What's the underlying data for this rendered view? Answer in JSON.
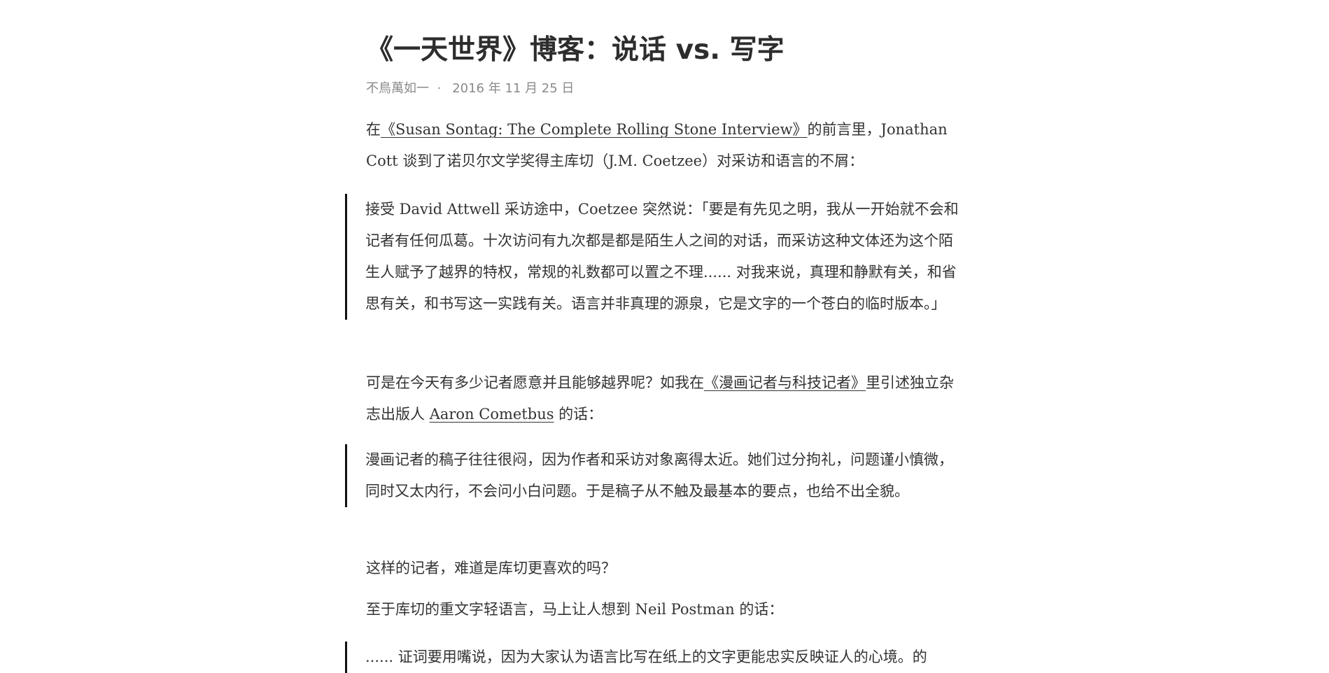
{
  "post": {
    "title": "《一天世界》博客：说话 vs. 写字",
    "author": "不鳥萬如一",
    "separator": "·",
    "date": "2016 年 11 月 25 日"
  },
  "paragraphs": {
    "p1_before": "在",
    "p1_link": "《Susan Sontag: The Complete Rolling Stone Interview》",
    "p1_after": "的前言里，Jonathan Cott 谈到了诺贝尔文学奖得主库切（J.M. Coetzee）对采访和语言的不屑：",
    "q1": "接受 David Attwell 采访途中，Coetzee 突然说：「要是有先见之明，我从一开始就不会和记者有任何瓜葛。十次访问有九次都是都是陌生人之间的对话，而采访这种文体还为这个陌生人赋予了越界的特权，常规的礼数都可以置之不理...... 对我来说，真理和静默有关，和省思有关，和书写这一实践有关。语言并非真理的源泉，它是文字的一个苍白的临时版本。」",
    "p2_before": "可是在今天有多少记者愿意并且能够越界呢？如我在",
    "p2_link1": "《漫画记者与科技记者》",
    "p2_middle": "里引述独立杂志出版人 ",
    "p2_link2": "Aaron Cometbus",
    "p2_after": " 的话：",
    "q2": "漫画记者的稿子往往很闷，因为作者和采访对象离得太近。她们过分拘礼，问题谨小慎微，同时又太内行，不会问小白问题。于是稿子从不触及最基本的要点，也给不出全貌。",
    "p3": "这样的记者，难道是库切更喜欢的吗？",
    "p4": "至于库切的重文字轻语言，马上让人想到 Neil Postman 的话：",
    "q3": "...... 证词要用嘴说，因为大家认为语言比写在纸上的文字更能忠实反映证人的心境。的"
  }
}
